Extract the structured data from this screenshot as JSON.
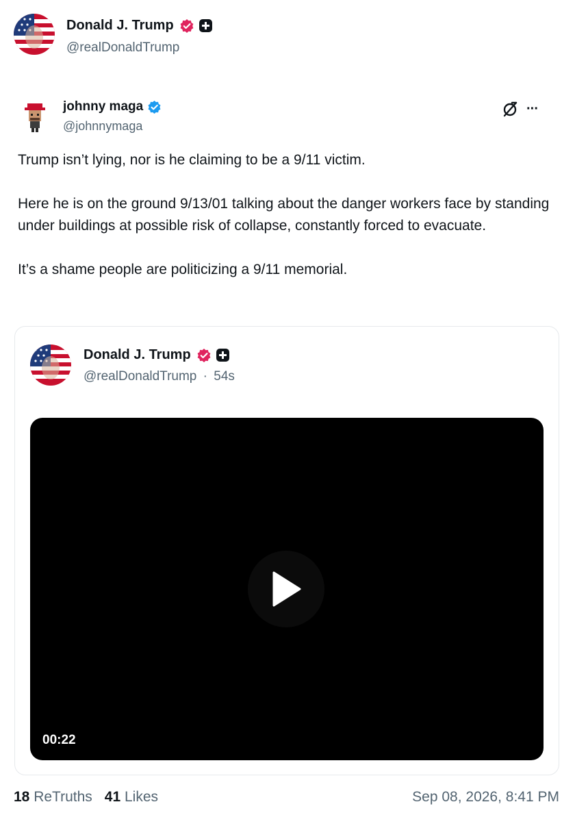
{
  "post": {
    "author": {
      "display_name": "Donald J. Trump",
      "handle": "@realDonaldTrump"
    },
    "quoted": {
      "author": {
        "display_name": "johnny maga",
        "handle": "@johnnymaga"
      },
      "body": [
        "Trump isn’t lying, nor is he claiming to be a 9/11 victim.",
        "Here he is on the ground 9/13/01 talking about the danger workers face by standing under buildings at possible risk of collapse, constantly forced to evacuate.",
        "It’s a shame people are politicizing a 9/11 memorial."
      ],
      "more_label": "···"
    },
    "card": {
      "author": {
        "display_name": "Donald J. Trump",
        "handle": "@realDonaldTrump",
        "age": "54s",
        "separator": "·"
      },
      "video": {
        "duration": "00:22"
      }
    },
    "stats": {
      "retruths_count": "18",
      "retruths_label": "ReTruths",
      "likes_count": "41",
      "likes_label": "Likes"
    },
    "timestamp": "Sep 08, 2026, 8:41 PM"
  },
  "colors": {
    "verified_pink": "#e0245e",
    "verified_blue": "#1d9bf0",
    "text_primary": "#0f1419",
    "text_secondary": "#536471"
  }
}
